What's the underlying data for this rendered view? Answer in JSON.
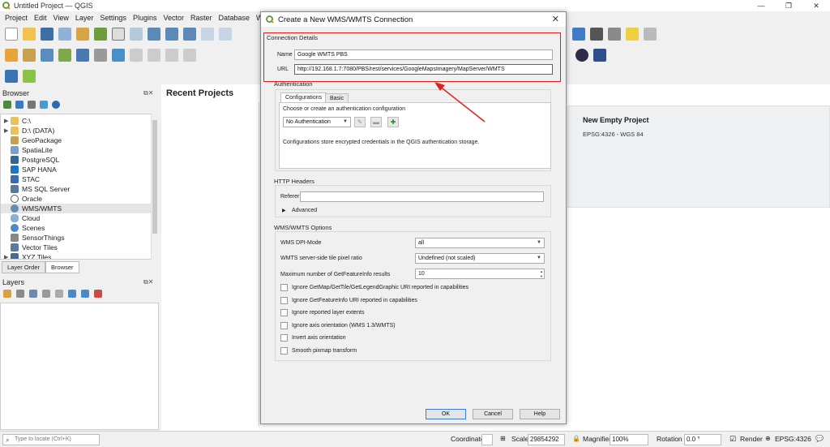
{
  "app": {
    "window_title": "Untitled Project — QGIS",
    "menu": [
      "Project",
      "Edit",
      "View",
      "Layer",
      "Settings",
      "Plugins",
      "Vector",
      "Raster",
      "Database",
      "Web"
    ]
  },
  "browser": {
    "title": "Browser",
    "items": [
      {
        "label": "C:\\",
        "icon": "folder-icon",
        "expandable": true
      },
      {
        "label": "D:\\ (DATA)",
        "icon": "folder-icon",
        "expandable": true
      },
      {
        "label": "GeoPackage",
        "icon": "geopackage-icon",
        "expandable": false
      },
      {
        "label": "SpatiaLite",
        "icon": "spatialite-icon",
        "expandable": false
      },
      {
        "label": "PostgreSQL",
        "icon": "postgresql-icon",
        "expandable": false
      },
      {
        "label": "SAP HANA",
        "icon": "sap-hana-icon",
        "expandable": false
      },
      {
        "label": "STAC",
        "icon": "stac-icon",
        "expandable": false
      },
      {
        "label": "MS SQL Server",
        "icon": "mssql-icon",
        "expandable": false
      },
      {
        "label": "Oracle",
        "icon": "oracle-icon",
        "expandable": false
      },
      {
        "label": "WMS/WMTS",
        "icon": "wms-icon",
        "expandable": false
      },
      {
        "label": "Cloud",
        "icon": "cloud-icon",
        "expandable": false
      },
      {
        "label": "Scenes",
        "icon": "scenes-icon",
        "expandable": false
      },
      {
        "label": "SensorThings",
        "icon": "sensorthings-icon",
        "expandable": false
      },
      {
        "label": "Vector Tiles",
        "icon": "vector-tiles-icon",
        "expandable": false
      },
      {
        "label": "XYZ Tiles",
        "icon": "xyz-tiles-icon",
        "expandable": true
      }
    ],
    "tabs": [
      "Layer Order",
      "Browser"
    ]
  },
  "layers": {
    "title": "Layers"
  },
  "recent": {
    "title": "Recent Projects",
    "template_title": "New Empty Project",
    "template_crs": "EPSG:4326 - WGS 84"
  },
  "dialog": {
    "title": "Create a New WMS/WMTS Connection",
    "connection_details_label": "Connection Details",
    "name_label": "Name",
    "name_value": "Google WMTS PBS",
    "url_label": "URL",
    "url_value": "http://192.168.1.7:7080/PBS/rest/services/GoogleMapsImagery/MapServer/WMTS",
    "authentication_label": "Authentication",
    "auth_tabs": [
      "Configurations",
      "Basic"
    ],
    "auth_choose_label": "Choose or create an authentication configuration",
    "auth_combo_value": "No Authentication",
    "auth_note": "Configurations store encrypted credentials in the QGIS authentication storage.",
    "http_headers_label": "HTTP Headers",
    "referer_label": "Referer",
    "referer_value": "",
    "advanced_label": "Advanced",
    "wms_options_label": "WMS/WMTS Options",
    "dpi_mode_label": "WMS DPI-Mode",
    "dpi_mode_value": "all",
    "tile_ratio_label": "WMTS server-side tile pixel ratio",
    "tile_ratio_value": "Undefined (not scaled)",
    "max_feature_label": "Maximum number of GetFeatureInfo results",
    "max_feature_value": "10",
    "checkboxes": [
      "Ignore GetMap/GetTile/GetLegendGraphic URI reported in capabilities",
      "Ignore GetFeatureInfo URI reported in capabilities",
      "Ignore reported layer extents",
      "Ignore axis orientation (WMS 1.3/WMTS)",
      "Invert axis orientation",
      "Smooth pixmap transform"
    ],
    "buttons": {
      "ok": "OK",
      "cancel": "Cancel",
      "help": "Help"
    }
  },
  "status": {
    "locate_placeholder": "Type to locate (Ctrl+K)",
    "coordinate_label": "Coordinate",
    "coordinate_value": "",
    "scale_label": "Scale",
    "scale_value": "29854292",
    "magnifier_label": "Magnifier",
    "magnifier_value": "100%",
    "rotation_label": "Rotation",
    "rotation_value": "0.0 °",
    "render_label": "Render",
    "crs_label": "EPSG:4326"
  },
  "colors": {
    "highlight": "#e02020",
    "accent": "#1e74c8",
    "qgis_green": "#589632"
  }
}
